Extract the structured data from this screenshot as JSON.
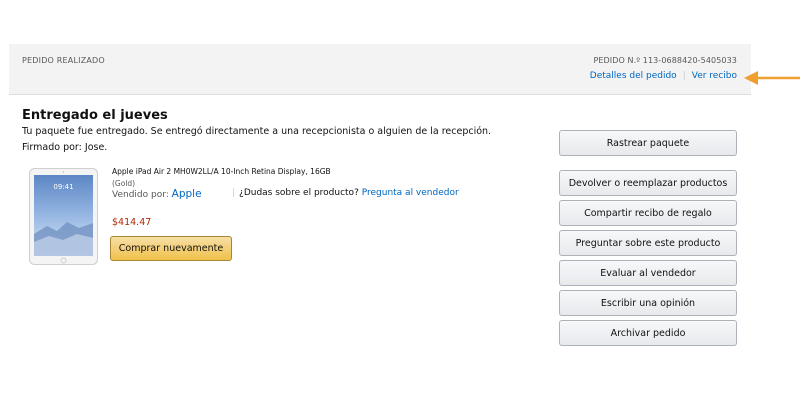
{
  "header": {
    "placed_label": "PEDIDO REALIZADO",
    "order_number": "PEDIDO N.º 113-0688420-5405033",
    "details_link": "Detalles del pedido",
    "receipt_link": "Ver recibo",
    "link_separator": "|"
  },
  "annotation": {
    "arrow_icon": "arrow-left-icon",
    "arrow_color": "#f0a030"
  },
  "shipment": {
    "status_title": "Entregado el jueves",
    "status_text": "Tu paquete fue entregado. Se entregó directamente a una recepcionista o alguien de la recepción.",
    "signed_by": "Firmado por: Jose."
  },
  "item": {
    "image_icon": "ipad-product-image",
    "image_clock": "09:41",
    "title": "Apple iPad Air 2 MH0W2LL/A 10-Inch Retina Display, 16GB",
    "condition": "(Gold)",
    "sold_by_label": "Vendido por:",
    "seller": "Apple",
    "question_separator": "|",
    "question_text": "¿Dudas sobre el producto?",
    "question_link": "Pregunta al vendedor",
    "price": "$414.47",
    "buy_again_label": "Comprar nuevamente"
  },
  "actions": {
    "track": "Rastrear paquete",
    "return": "Devolver o reemplazar productos",
    "gift_receipt": "Compartir recibo de regalo",
    "ask_product": "Preguntar sobre este producto",
    "rate_seller": "Evaluar al vendedor",
    "write_review": "Escribir una opinión",
    "archive": "Archivar pedido"
  },
  "colors": {
    "link": "#0066c0",
    "price": "#b12704",
    "header_bg": "#f3f3f3",
    "buy_button": "#f0c14b"
  }
}
